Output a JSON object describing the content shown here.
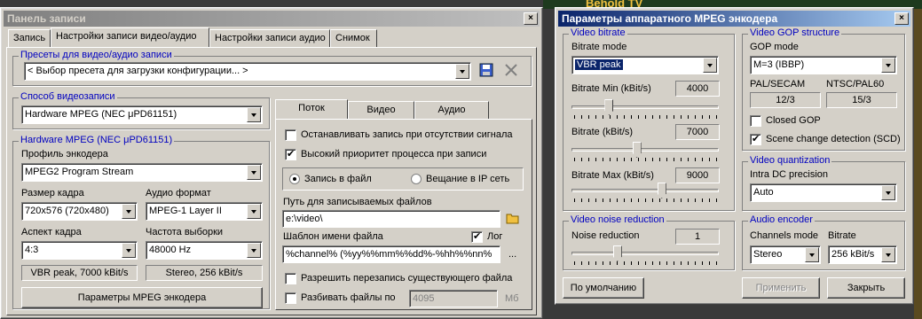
{
  "bg_strip": {
    "text": "Behold TV"
  },
  "left": {
    "title": "Панель записи",
    "close": "×",
    "tabs": [
      "Запись",
      "Настройки записи видео/аудио",
      "Настройки записи аудио",
      "Снимок"
    ],
    "presets": {
      "legend": "Пресеты для видео/аудио записи",
      "value": "< Выбор пресета для загрузки конфигурации... >"
    },
    "method": {
      "legend": "Способ видеозаписи",
      "value": "Hardware MPEG (NEC μPD61151)"
    },
    "hw": {
      "legend": "Hardware MPEG (NEC μPD61151)",
      "profile_label": "Профиль энкодера",
      "profile_value": "MPEG2 Program Stream",
      "size_label": "Размер кадра",
      "size_value": "720x576 (720x480)",
      "audio_label": "Аудио формат",
      "audio_value": "MPEG-1 Layer II",
      "aspect_label": "Аспект кадра",
      "aspect_value": "4:3",
      "rate_label": "Частота выборки",
      "rate_value": "48000 Hz",
      "video_summary": "VBR peak, 7000 kBit/s",
      "audio_summary": "Stereo, 256 kBit/s",
      "params_button": "Параметры MPEG энкодера"
    },
    "subtabs": [
      "Поток",
      "Видео",
      "Аудио"
    ],
    "stop_no_signal": "Останавливать запись при отсутствии сигнала",
    "high_priority": "Высокий приоритет процесса при записи",
    "to_file": "Запись в файл",
    "to_ip": "Вещание в IP сеть",
    "path_label": "Путь для записываемых файлов",
    "path_value": "e:\\video\\",
    "template_label": "Шаблон имени файла",
    "log_label": "Лог",
    "template_value": "%channel% (%yy%%mm%%dd%-%hh%%nn%",
    "ellipsis": "...",
    "allow_overwrite": "Разрешить перезапись существующего файла",
    "split_files": "Разбивать файлы по",
    "split_value": "4095",
    "split_unit": "Мб"
  },
  "right": {
    "title": "Параметры аппаратного MPEG энкодера",
    "close": "×",
    "video_bitrate": {
      "legend": "Video bitrate",
      "mode_label": "Bitrate mode",
      "mode_value": "VBR peak",
      "min_label": "Bitrate Min (kBit/s)",
      "min_value": "4000",
      "br_label": "Bitrate (kBit/s)",
      "br_value": "7000",
      "max_label": "Bitrate Max (kBit/s)",
      "max_value": "9000",
      "min_level": 0.24,
      "br_level": 0.44,
      "max_level": 0.62
    },
    "gop": {
      "legend": "Video GOP structure",
      "mode_label": "GOP mode",
      "mode_value": "M=3 (IBBP)",
      "pal_label": "PAL/SECAM",
      "pal_value": "12/3",
      "ntsc_label": "NTSC/PAL60",
      "ntsc_value": "15/3",
      "closed_gop": "Closed GOP",
      "scene_change": "Scene change detection (SCD)"
    },
    "noise": {
      "legend": "Video noise reduction",
      "label": "Noise reduction",
      "value": "1",
      "level": 0.3
    },
    "quant": {
      "legend": "Video quantization",
      "label": "Intra DC precision",
      "value": "Auto"
    },
    "audio": {
      "legend": "Audio encoder",
      "channels_label": "Channels mode",
      "channels_value": "Stereo",
      "bitrate_label": "Bitrate",
      "bitrate_value": "256 kBit/s"
    },
    "default_button": "По умолчанию",
    "apply_button": "Применить",
    "close_button": "Закрыть"
  }
}
